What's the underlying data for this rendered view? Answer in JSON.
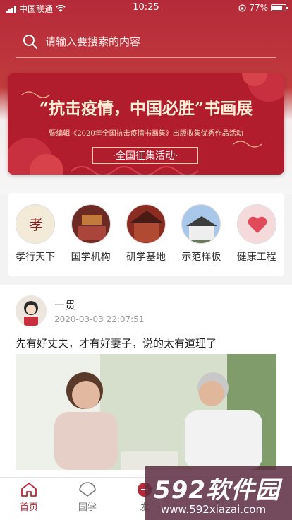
{
  "status_bar": {
    "carrier": "中国联通",
    "time": "10:25",
    "battery": "77%",
    "battery_level": 0.77
  },
  "search": {
    "placeholder": "请输入要搜索的内容"
  },
  "banner": {
    "title": "“抗击疫情，中国必胜”书画展",
    "subtitle": "暨编辑《2020年全国抗击疫情书画集》出版收集优秀作品活动",
    "button": "·全国征集活动·"
  },
  "categories": [
    {
      "label": "孝行天下",
      "icon": "xiaoxing-icon"
    },
    {
      "label": "国学机构",
      "icon": "guoxue-jigou-icon"
    },
    {
      "label": "研学基地",
      "icon": "yanxue-jidi-icon"
    },
    {
      "label": "示范样板",
      "icon": "shifan-yangban-icon"
    },
    {
      "label": "健康工程",
      "icon": "jiankang-gongcheng-icon"
    }
  ],
  "post": {
    "author": "一贯",
    "time": "2020-03-03 22:07:51",
    "text": "先有好丈夫，才有好妻子，说的太有道理了"
  },
  "tabbar": [
    {
      "label": "首页",
      "icon": "home-icon",
      "active": true
    },
    {
      "label": "国学",
      "icon": "fan-icon",
      "active": false
    },
    {
      "label": "发",
      "icon": "publish-icon",
      "active": false
    }
  ],
  "watermark": {
    "brand": "592软件园",
    "url": "www.592xiazai.com"
  },
  "colors": {
    "primary": "#b52a3a",
    "banner": "#b21d2e"
  }
}
